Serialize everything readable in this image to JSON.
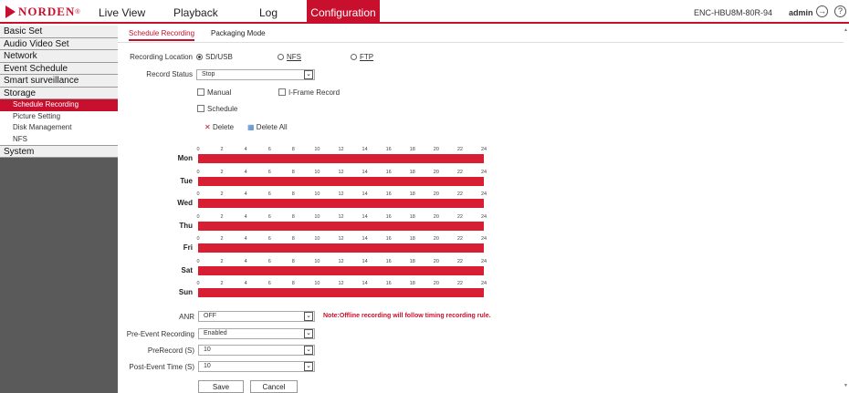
{
  "header": {
    "brand": "NORDEN",
    "brand_mark": "®",
    "nav": [
      "Live View",
      "Playback",
      "Log",
      "Configuration"
    ],
    "device_name": "ENC-HBU8M-80R-94",
    "user": "admin",
    "logout_icon": "logout-icon",
    "help_icon": "help-icon"
  },
  "sidebar": {
    "sections": [
      {
        "label": "Basic Set"
      },
      {
        "label": "Audio Video Set"
      },
      {
        "label": "Network"
      },
      {
        "label": "Event Schedule"
      },
      {
        "label": "Smart surveillance"
      },
      {
        "label": "Storage"
      }
    ],
    "storage_items": [
      "Schedule Recording",
      "Picture Setting",
      "Disk Management",
      "NFS"
    ],
    "system": "System"
  },
  "tabs": [
    "Schedule Recording",
    "Packaging Mode"
  ],
  "form": {
    "recording_location_label": "Recording Location",
    "location_options": [
      "SD/USB",
      "NFS",
      "FTP"
    ],
    "record_status_label": "Record Status",
    "record_status_value": "Stop",
    "manual_label": "Manual",
    "iframe_label": "I-Frame Record",
    "schedule_label": "Schedule",
    "delete_label": "Delete",
    "delete_all_label": "Delete All"
  },
  "schedule": {
    "days": [
      "Mon",
      "Tue",
      "Wed",
      "Thu",
      "Fri",
      "Sat",
      "Sun"
    ],
    "hour_ticks": [
      "0",
      "2",
      "4",
      "6",
      "8",
      "10",
      "12",
      "14",
      "16",
      "18",
      "20",
      "22",
      "24"
    ]
  },
  "options": {
    "anr_label": "ANR",
    "anr_value": "OFF",
    "note": "Note:Offline recording will follow timing recording rule.",
    "pre_event_label": "Pre-Event Recording",
    "pre_event_value": "Enabled",
    "prerecord_label": "PreRecord (S)",
    "prerecord_value": "10",
    "post_event_label": "Post-Event Time (S)",
    "post_event_value": "10"
  },
  "buttons": {
    "save": "Save",
    "cancel": "Cancel"
  },
  "colors": {
    "accent": "#c8102e",
    "schedule_bar": "#d81e33",
    "sidebar_bg": "#5a5a5a"
  }
}
